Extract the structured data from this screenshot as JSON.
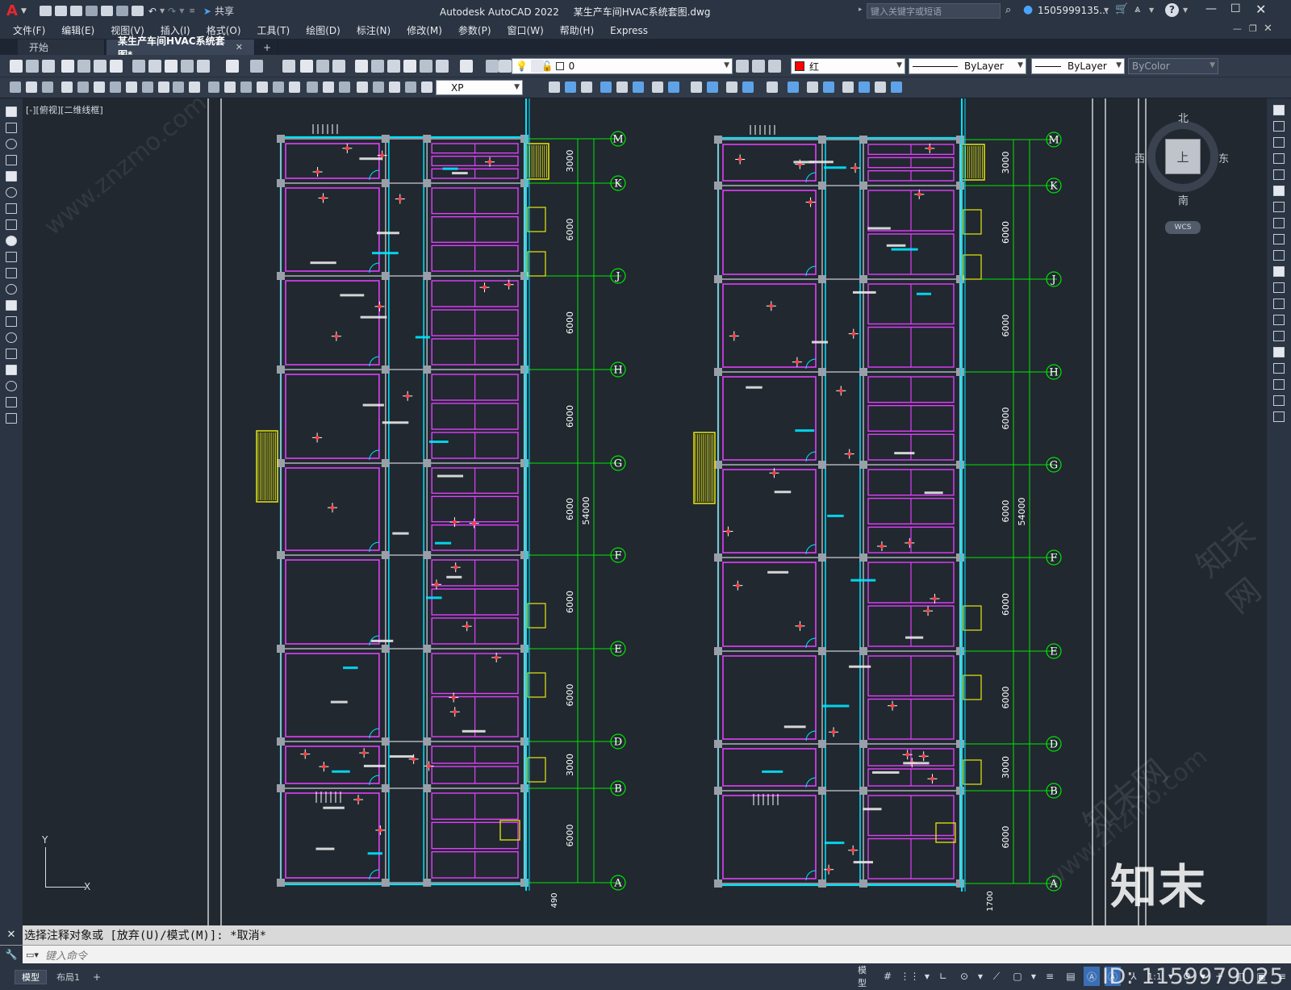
{
  "app": {
    "title": "Autodesk AutoCAD 2022",
    "filename": "某生产车间HVAC系统套图.dwg",
    "search_placeholder": "键入关键字或短语",
    "user": "1505999135...",
    "share_label": "共享",
    "logo_letter": "A"
  },
  "menu": [
    "文件(F)",
    "编辑(E)",
    "视图(V)",
    "插入(I)",
    "格式(O)",
    "工具(T)",
    "绘图(D)",
    "标注(N)",
    "修改(M)",
    "参数(P)",
    "窗口(W)",
    "帮助(H)",
    "Express"
  ],
  "tabs": {
    "start": "开始",
    "doc": "某生产车间HVAC系统套图*",
    "add": "+"
  },
  "toolbar": {
    "layer_value": "0",
    "color_value": "红",
    "linetype_value": "ByLayer",
    "lineweight_value": "ByLayer",
    "plotstyle_value": "ByColor",
    "dimstyle_value": "XP"
  },
  "viewport": {
    "label": "[-][俯视][二维线框]",
    "compass": {
      "n": "北",
      "s": "南",
      "e": "东",
      "w": "西",
      "top": "上",
      "wcs": "WCS"
    },
    "ucs_x": "X",
    "ucs_y": "Y"
  },
  "drawing": {
    "grid_labels": [
      "M",
      "K",
      "J",
      "H",
      "G",
      "F",
      "E",
      "D",
      "B",
      "A"
    ],
    "dims_left": [
      "3000",
      "6000",
      "6000",
      "6000",
      "6000",
      "6000",
      "6000",
      "3000",
      "6000"
    ],
    "overall_dim": "54000",
    "bottom_dim": "490",
    "bottom_dim_right": "1700",
    "colors": {
      "wall": "#e040fb",
      "grid": "#00e600",
      "duct": "#00e5ff",
      "text": "#ffffff",
      "yellow": "#e8e80a",
      "red": "#ff4040"
    }
  },
  "command": {
    "history": "选择注释对象或 [放弃(U)/模式(M)]: *取消*",
    "placeholder": "键入命令"
  },
  "status": {
    "model_tab": "模型",
    "layout_tab": "布局1",
    "add": "+",
    "model_label": "模型",
    "scale": "1:1"
  },
  "watermark": {
    "logo": "知末",
    "id_text": "ID: 1159979025",
    "site": "www.znzmo.com",
    "site_cn": "知末网"
  }
}
